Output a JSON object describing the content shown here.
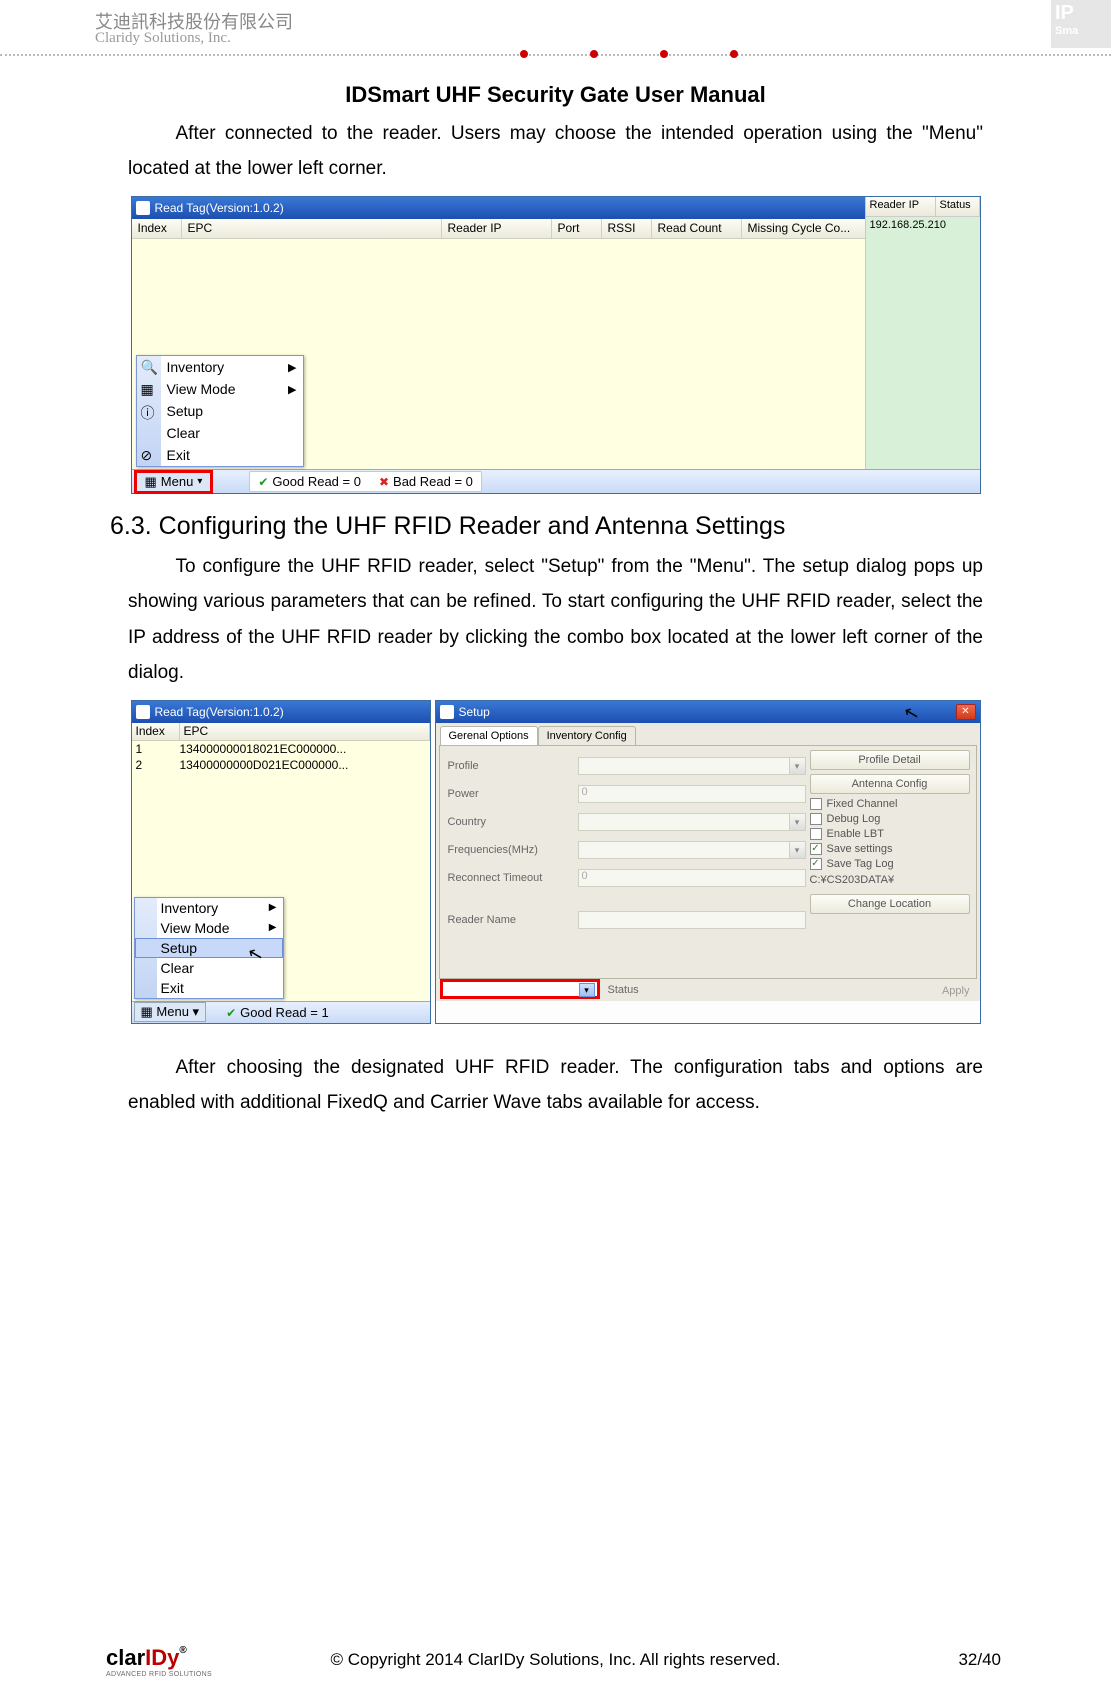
{
  "header": {
    "company_zh": "艾迪訊科技股份有限公司",
    "company_en": "Claridy Solutions, Inc.",
    "watermark_top": "IP",
    "watermark_sub": "Sma"
  },
  "doc_title": "IDSmart UHF Security Gate User Manual",
  "para1": "After connected to the reader. Users may choose the intended operation using the \"Menu\" located at the lower left corner.",
  "section_h": "6.3. Configuring the UHF RFID Reader and Antenna Settings",
  "para2": "To configure the UHF RFID reader, select \"Setup\" from the \"Menu\". The setup dialog pops up showing various parameters that can be refined. To start configuring the UHF RFID reader, select the IP address of the UHF RFID reader by clicking the combo box located at the lower left corner of the dialog.",
  "para3": "After choosing the designated UHF RFID reader. The configuration tabs and options are enabled with additional FixedQ and Carrier Wave tabs available for access.",
  "sc1": {
    "title": "Read Tag(Version:1.0.2)",
    "cols": [
      "Index",
      "EPC",
      "Reader IP",
      "Port",
      "RSSI",
      "Read Count",
      "Missing Cycle Co..."
    ],
    "side_cols": [
      "Reader IP",
      "Status"
    ],
    "side_row": "192.168.25.210",
    "menu": [
      "Inventory",
      "View Mode",
      "Setup",
      "Clear",
      "Exit"
    ],
    "menu_btn": "Menu",
    "good": "Good Read = 0",
    "bad": "Bad Read = 0"
  },
  "sc2a": {
    "title": "Read Tag(Version:1.0.2)",
    "cols": [
      "Index",
      "EPC"
    ],
    "rows": [
      {
        "idx": "1",
        "epc": "134000000018021EC000000..."
      },
      {
        "idx": "2",
        "epc": "13400000000D021EC000000..."
      }
    ],
    "menu": [
      "Inventory",
      "View Mode",
      "Setup",
      "Clear",
      "Exit"
    ],
    "menu_btn": "Menu",
    "good": "Good Read = 1"
  },
  "sc2b": {
    "title": "Setup",
    "tabs": [
      "Gerenal Options",
      "Inventory Config"
    ],
    "labels": {
      "profile": "Profile",
      "power": "Power",
      "country": "Country",
      "freq": "Frequencies(MHz)",
      "reconnect": "Reconnect Timeout",
      "reader_name": "Reader Name"
    },
    "values": {
      "power": "0",
      "reconnect": "0"
    },
    "right": {
      "profile_detail": "Profile Detail",
      "antenna_config": "Antenna Config",
      "fixed_channel": "Fixed Channel",
      "debug_log": "Debug Log",
      "enable_lbt": "Enable LBT",
      "save_settings": "Save settings",
      "save_tag_log": "Save Tag Log",
      "path": "C:¥CS203DATA¥",
      "change_location": "Change Location"
    },
    "status": "Status",
    "apply": "Apply"
  },
  "footer": {
    "brand_a": "clar",
    "brand_b": "IDy",
    "reg": "®",
    "tag": "ADVANCED RFID SOLUTIONS",
    "copyright": "© Copyright 2014 ClarIDy Solutions, Inc. All rights reserved.",
    "page": "32/40"
  }
}
